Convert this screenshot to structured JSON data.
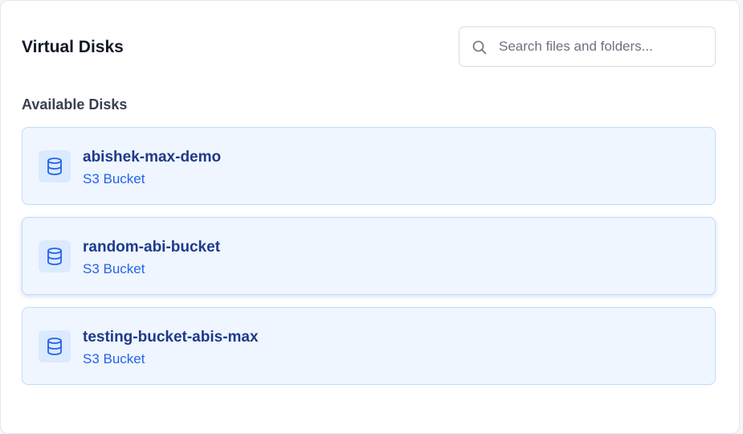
{
  "header": {
    "title": "Virtual Disks"
  },
  "search": {
    "placeholder": "Search files and folders..."
  },
  "section": {
    "label": "Available Disks"
  },
  "disks": [
    {
      "name": "abishek-max-demo",
      "type": "S3 Bucket"
    },
    {
      "name": "random-abi-bucket",
      "type": "S3 Bucket"
    },
    {
      "name": "testing-bucket-abis-max",
      "type": "S3 Bucket"
    }
  ],
  "icons": {
    "search": "search-icon",
    "disk": "database-icon"
  },
  "colors": {
    "card_bg": "#eff6ff",
    "card_border": "#bfdbfe",
    "accent": "#2563eb",
    "name_text": "#1e3a8a"
  }
}
